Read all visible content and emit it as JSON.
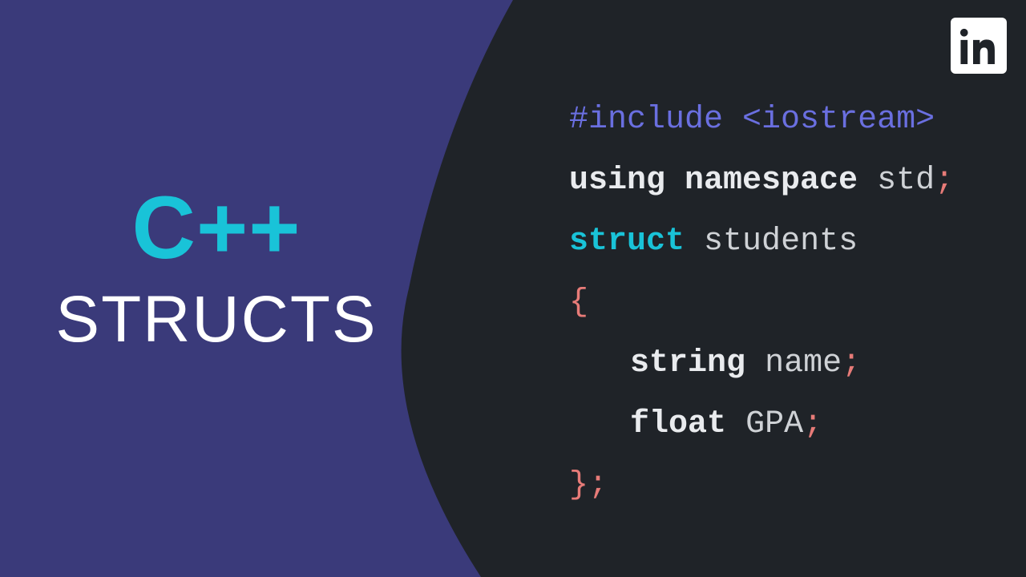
{
  "title": {
    "line1": "C++",
    "line2": "STRUCTS"
  },
  "logo": {
    "name": "linkedin"
  },
  "code": {
    "include_kw": "#include",
    "include_target": "<iostream>",
    "using_kw": "using namespace",
    "using_ns": "std",
    "semi": ";",
    "struct_kw": "struct",
    "struct_name": "students",
    "lbrace": "{",
    "field1_type": "string",
    "field1_name": "name",
    "field2_type": "float",
    "field2_name": "GPA",
    "rbrace": "}"
  },
  "colors": {
    "bg_left": "#3a3a7a",
    "bg_right": "#1f2328",
    "accent_cyan": "#19c3d8",
    "accent_purple": "#6a6fe0",
    "accent_rose": "#e77b78"
  }
}
